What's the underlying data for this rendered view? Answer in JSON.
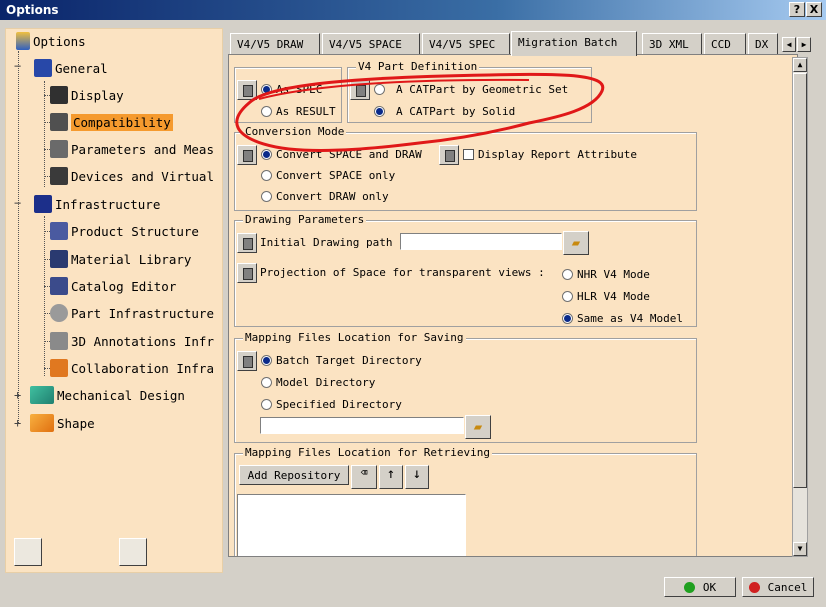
{
  "window": {
    "title": "Options",
    "help_label": "?",
    "close_label": "X"
  },
  "tree": {
    "items": [
      {
        "label": "Options"
      },
      {
        "label": "General"
      },
      {
        "label": "Display"
      },
      {
        "label": "Compatibility"
      },
      {
        "label": "Parameters and Meas"
      },
      {
        "label": "Devices and Virtual"
      },
      {
        "label": "Infrastructure"
      },
      {
        "label": "Product Structure"
      },
      {
        "label": "Material Library"
      },
      {
        "label": "Catalog Editor"
      },
      {
        "label": "Part Infrastructure"
      },
      {
        "label": "3D Annotations Infr"
      },
      {
        "label": "Collaboration Infra"
      },
      {
        "label": "Mechanical Design"
      },
      {
        "label": "Shape"
      }
    ],
    "selected": "Compatibility"
  },
  "tabs": [
    "V4/V5 DRAW",
    "V4/V5 SPACE",
    "V4/V5 SPEC",
    "Migration Batch",
    "3D XML",
    "CCD",
    "DX"
  ],
  "active_tab": "Migration Batch",
  "scope_group": {
    "title": "",
    "options": [
      "As SPEC",
      "As RESULT"
    ],
    "selected": "As SPEC"
  },
  "v4_part": {
    "title": "V4 Part Definition",
    "options": [
      "A CATPart by Geometric Set",
      "A CATPart by Solid"
    ],
    "selected": "A CATPart by Solid"
  },
  "conversion": {
    "title": "Conversion Mode",
    "options": [
      "Convert SPACE and DRAW",
      "Convert SPACE only",
      "Convert DRAW only"
    ],
    "selected": "Convert SPACE and DRAW",
    "display_report_label": "Display Report Attribute"
  },
  "drawing": {
    "title": "Drawing Parameters",
    "path_label": "Initial Drawing path",
    "path_value": "",
    "projection_label": "Projection of Space for transparent views :",
    "projection_options": [
      "NHR V4 Mode",
      "HLR V4 Mode",
      "Same as V4 Model"
    ],
    "projection_selected": "Same as V4 Model"
  },
  "mapping_saving": {
    "title": "Mapping Files Location for Saving",
    "options": [
      "Batch Target Directory",
      "Model Directory",
      "Specified Directory"
    ],
    "selected": "Batch Target Directory",
    "dir_value": ""
  },
  "mapping_retrieving": {
    "title": "Mapping Files Location for Retrieving",
    "add_button": "Add Repository"
  },
  "dialog": {
    "ok": "OK",
    "cancel": "Cancel"
  },
  "colors": {
    "panel": "#fbe3c2",
    "selection": "#f59a2e",
    "annotation": "#e01818",
    "titlebar": "#0a246a"
  }
}
